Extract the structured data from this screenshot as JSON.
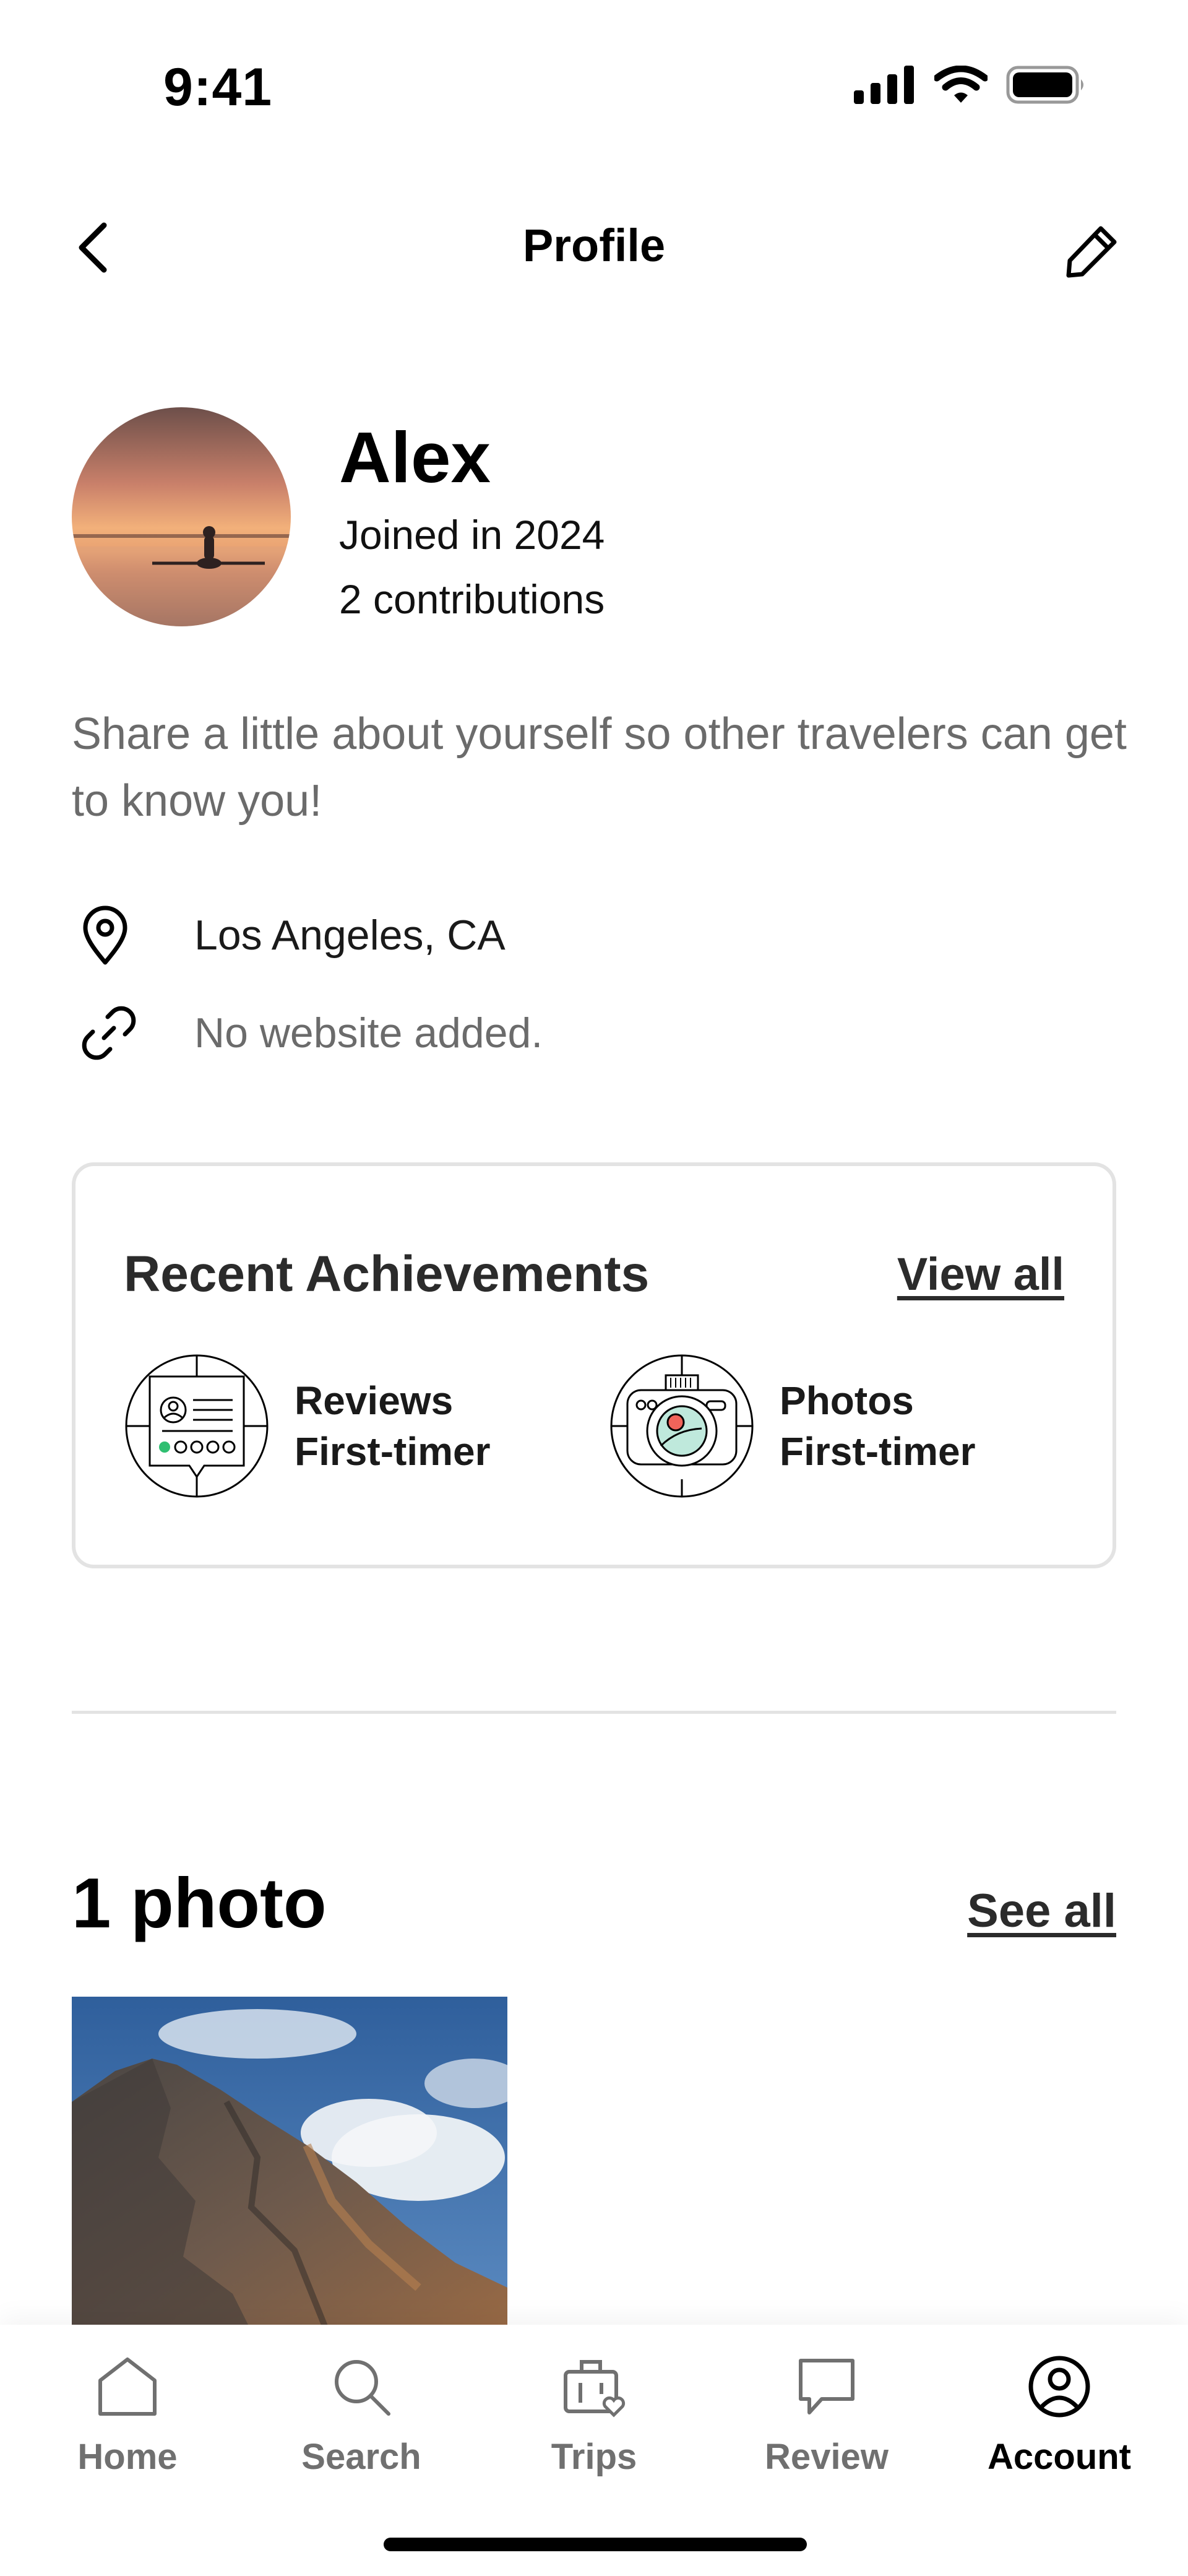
{
  "status_bar": {
    "time": "9:41"
  },
  "nav": {
    "title": "Profile"
  },
  "profile": {
    "name": "Alex",
    "joined": "Joined in 2024",
    "contributions": "2 contributions",
    "bio_prompt": "Share a little about yourself so other travelers can get to know you!",
    "location": "Los Angeles, CA",
    "website": "No website added."
  },
  "achievements": {
    "title": "Recent Achievements",
    "view_all": "View all",
    "items": [
      {
        "line1": "Reviews",
        "line2": "First-timer",
        "icon": "reviews-badge-icon"
      },
      {
        "line1": "Photos",
        "line2": "First-timer",
        "icon": "photos-badge-icon"
      }
    ]
  },
  "photos": {
    "title": "1 photo",
    "see_all": "See all"
  },
  "tabs": [
    {
      "label": "Home",
      "icon": "home-icon",
      "active": false
    },
    {
      "label": "Search",
      "icon": "search-icon",
      "active": false
    },
    {
      "label": "Trips",
      "icon": "trips-icon",
      "active": false
    },
    {
      "label": "Review",
      "icon": "review-icon",
      "active": false
    },
    {
      "label": "Account",
      "icon": "account-icon",
      "active": true
    }
  ],
  "colors": {
    "primary_text": "#000000",
    "muted_text": "#6b6b6b",
    "card_border": "#e3e3e3",
    "badge_green": "#2fbf71",
    "badge_red": "#f0645a",
    "badge_teal": "#bfe9dc"
  }
}
